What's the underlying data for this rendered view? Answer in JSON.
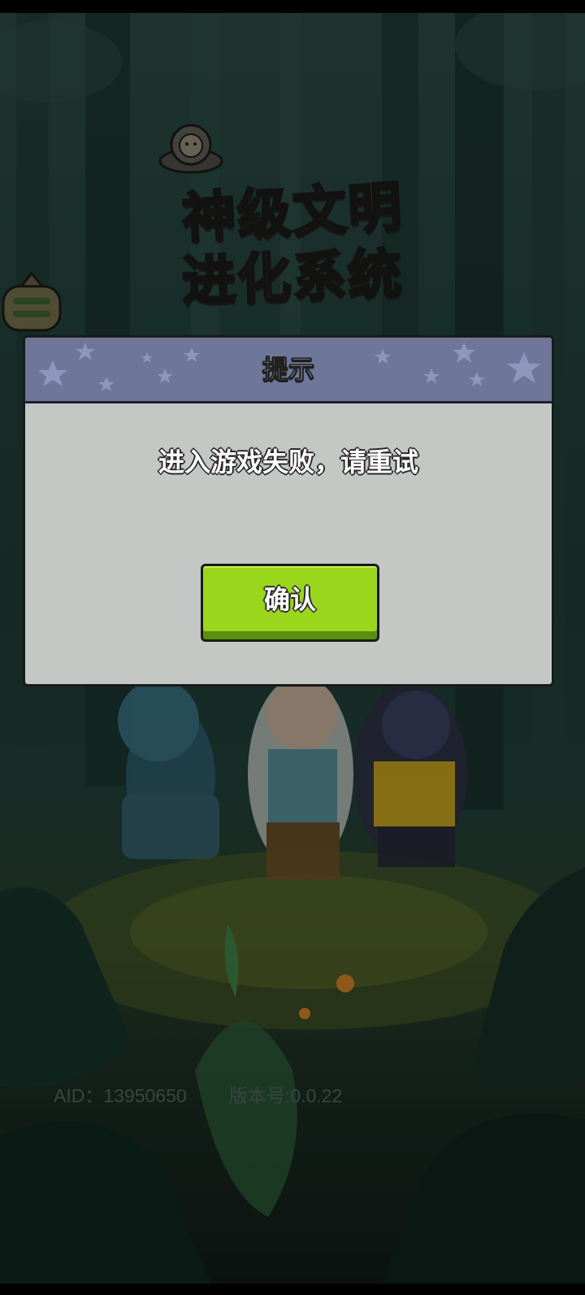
{
  "game": {
    "title_line1": "神级文明",
    "title_line2": "进化系统"
  },
  "dialog": {
    "title": "提示",
    "message": "进入游戏失败，请重试",
    "confirm_label": "确认"
  },
  "footer": {
    "aid": "AID：13950650",
    "version": "版本号:0.0.22"
  },
  "icons": {
    "menu": "menu-icon",
    "mascot": "astronaut-mascot-icon",
    "stars": "star-icon"
  },
  "colors": {
    "dialog_header": "#6e779a",
    "dialog_body": "#c3c8c5",
    "confirm_button": "#9ad61c",
    "footer_text": "#50605a"
  }
}
